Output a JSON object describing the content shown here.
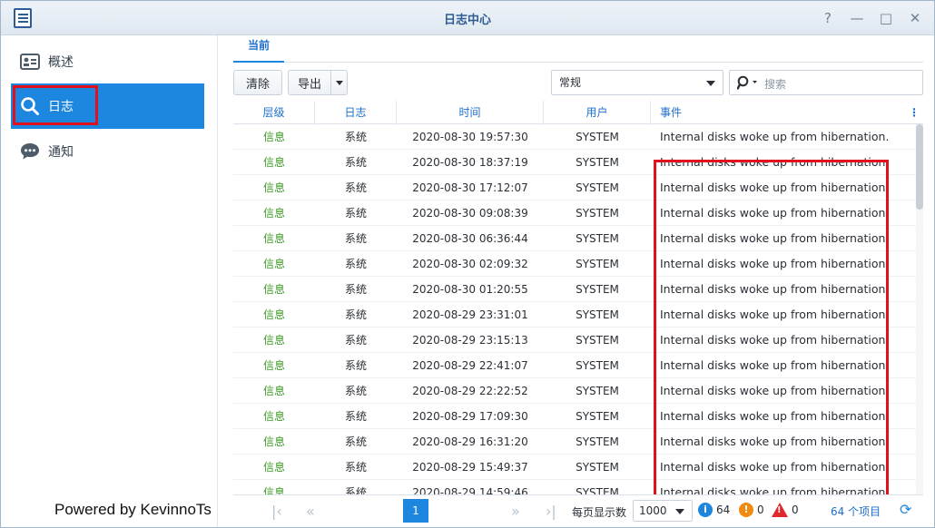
{
  "window": {
    "title": "日志中心",
    "buttons": [
      "?",
      "—",
      "□",
      "✕"
    ]
  },
  "sidebar": {
    "items": [
      {
        "label": "概述",
        "icon": "overview-card-icon"
      },
      {
        "label": "日志",
        "icon": "search-icon",
        "active": true
      },
      {
        "label": "通知",
        "icon": "chat-bubble-icon"
      }
    ],
    "footer": "Powered by KevinnoTs"
  },
  "tabs": [
    {
      "label": "当前",
      "active": true
    }
  ],
  "toolbar": {
    "clear_label": "清除",
    "export_label": "导出",
    "filter_value": "常规",
    "search_placeholder": "搜索"
  },
  "table": {
    "headers": [
      "层级",
      "日志",
      "时间",
      "用户",
      "事件"
    ],
    "rows": [
      {
        "level": "信息",
        "log": "系统",
        "time": "2020-08-30 19:57:30",
        "user": "SYSTEM",
        "event": "Internal disks woke up from hibernation."
      },
      {
        "level": "信息",
        "log": "系统",
        "time": "2020-08-30 18:37:19",
        "user": "SYSTEM",
        "event": "Internal disks woke up from hibernation."
      },
      {
        "level": "信息",
        "log": "系统",
        "time": "2020-08-30 17:12:07",
        "user": "SYSTEM",
        "event": "Internal disks woke up from hibernation."
      },
      {
        "level": "信息",
        "log": "系统",
        "time": "2020-08-30 09:08:39",
        "user": "SYSTEM",
        "event": "Internal disks woke up from hibernation."
      },
      {
        "level": "信息",
        "log": "系统",
        "time": "2020-08-30 06:36:44",
        "user": "SYSTEM",
        "event": "Internal disks woke up from hibernation."
      },
      {
        "level": "信息",
        "log": "系统",
        "time": "2020-08-30 02:09:32",
        "user": "SYSTEM",
        "event": "Internal disks woke up from hibernation."
      },
      {
        "level": "信息",
        "log": "系统",
        "time": "2020-08-30 01:20:55",
        "user": "SYSTEM",
        "event": "Internal disks woke up from hibernation."
      },
      {
        "level": "信息",
        "log": "系统",
        "time": "2020-08-29 23:31:01",
        "user": "SYSTEM",
        "event": "Internal disks woke up from hibernation."
      },
      {
        "level": "信息",
        "log": "系统",
        "time": "2020-08-29 23:15:13",
        "user": "SYSTEM",
        "event": "Internal disks woke up from hibernation."
      },
      {
        "level": "信息",
        "log": "系统",
        "time": "2020-08-29 22:41:07",
        "user": "SYSTEM",
        "event": "Internal disks woke up from hibernation."
      },
      {
        "level": "信息",
        "log": "系统",
        "time": "2020-08-29 22:22:52",
        "user": "SYSTEM",
        "event": "Internal disks woke up from hibernation."
      },
      {
        "level": "信息",
        "log": "系统",
        "time": "2020-08-29 17:09:30",
        "user": "SYSTEM",
        "event": "Internal disks woke up from hibernation."
      },
      {
        "level": "信息",
        "log": "系统",
        "time": "2020-08-29 16:31:20",
        "user": "SYSTEM",
        "event": "Internal disks woke up from hibernation."
      },
      {
        "level": "信息",
        "log": "系统",
        "time": "2020-08-29 15:49:37",
        "user": "SYSTEM",
        "event": "Internal disks woke up from hibernation."
      },
      {
        "level": "信息",
        "log": "系统",
        "time": "2020-08-29 14:59:46",
        "user": "SYSTEM",
        "event": "Internal disks woke up from hibernation."
      }
    ]
  },
  "pager": {
    "current_page": "1",
    "per_page_label": "每页显示数",
    "per_page_value": "1000",
    "info_count": "64",
    "warning_count": "0",
    "error_count": "0",
    "total_label": "64 个项目"
  },
  "colors": {
    "accent": "#1d86df",
    "level_info": "#3d9a27",
    "highlight": "#e0101c"
  }
}
